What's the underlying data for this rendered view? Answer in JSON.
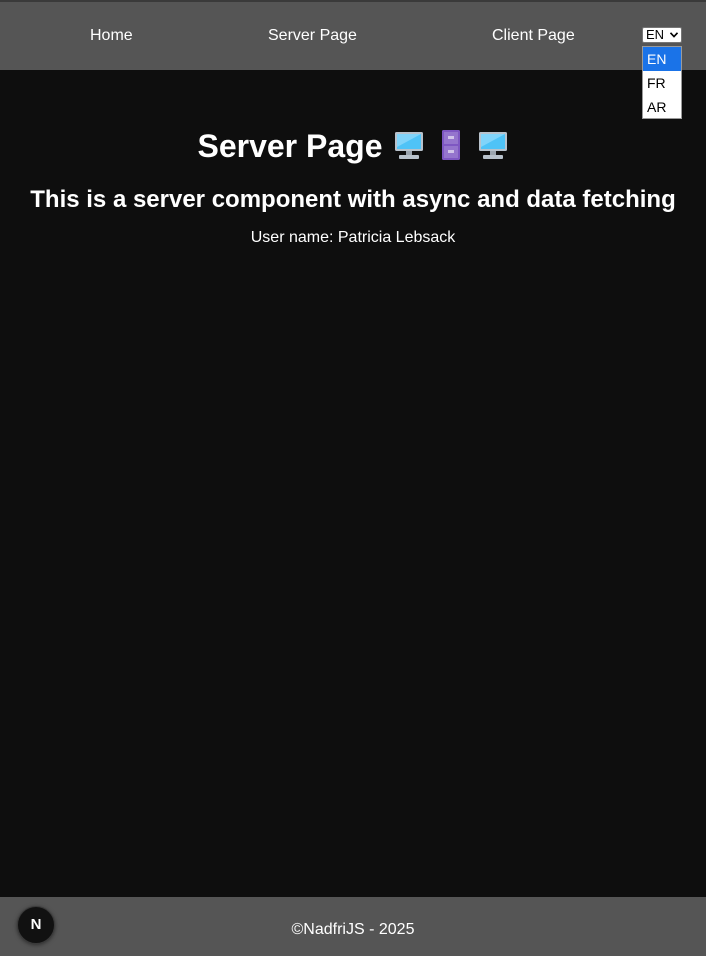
{
  "nav": {
    "home": "Home",
    "server": "Server Page",
    "client": "Client Page"
  },
  "language": {
    "selected": "EN",
    "options": [
      "EN",
      "FR",
      "AR"
    ]
  },
  "main": {
    "title": "Server Page",
    "title_icons": [
      "desktop-computer-icon",
      "file-cabinet-icon",
      "desktop-computer-icon"
    ],
    "subtitle": "This is a server component with async and data fetching",
    "user_line": "User name: Patricia Lebsack"
  },
  "footer": {
    "text": "©NadfriJS - 2025"
  },
  "badge": {
    "label": "N"
  },
  "colors": {
    "navbar": "#555555",
    "background": "#0e0e0e",
    "selected_option": "#1a73e8"
  }
}
